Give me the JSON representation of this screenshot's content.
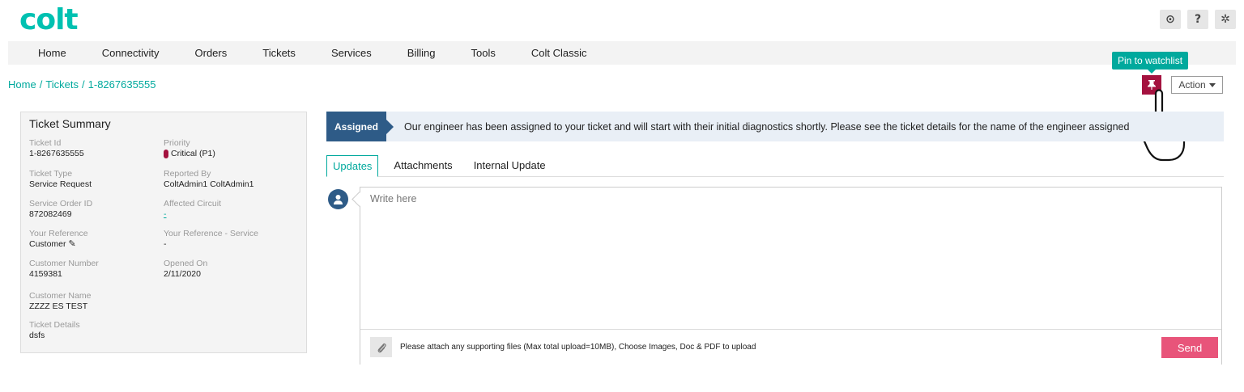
{
  "brand": {
    "logo_text": "colt",
    "accent_color": "#00c1b1"
  },
  "top_icons": [
    {
      "icon": "globe-icon",
      "glyph": "⊙"
    },
    {
      "icon": "help-icon",
      "glyph": "?"
    },
    {
      "icon": "gear-icon",
      "glyph": "✲"
    }
  ],
  "nav": [
    "Home",
    "Connectivity",
    "Orders",
    "Tickets",
    "Services",
    "Billing",
    "Tools",
    "Colt Classic"
  ],
  "breadcrumb": [
    "Home",
    "Tickets",
    "1-8267635555"
  ],
  "pin": {
    "tooltip": "Pin to watchlist",
    "icon": "pin-icon",
    "color": "#a4123f"
  },
  "action": {
    "label": "Action"
  },
  "summary": {
    "title": "Ticket Summary",
    "fields": [
      {
        "label": "Ticket Id",
        "value": "1-8267635555"
      },
      {
        "label": "Priority",
        "value": "Critical (P1)"
      },
      {
        "label": "Ticket Type",
        "value": "Service Request"
      },
      {
        "label": "Reported By",
        "value": "ColtAdmin1 ColtAdmin1"
      },
      {
        "label": "Service Order ID",
        "value": "872082469"
      },
      {
        "label": "Affected Circuit",
        "value": "-"
      },
      {
        "label": "Your Reference",
        "value": "Customer"
      },
      {
        "label": "Your Reference - Service",
        "value": "-"
      },
      {
        "label": "Customer Number",
        "value": "4159381"
      },
      {
        "label": "Opened On",
        "value": "2/11/2020"
      },
      {
        "label": "Customer Name",
        "value": "ZZZZ ES TEST"
      },
      {
        "label": "Ticket Details",
        "value": "dsfs"
      }
    ]
  },
  "status": {
    "tag": "Assigned",
    "message": "Our engineer has been assigned to your ticket and will start with their initial diagnostics shortly. Please see the ticket details for the name of the engineer assigned"
  },
  "tabs": [
    "Updates",
    "Attachments",
    "Internal Update"
  ],
  "comment": {
    "placeholder": "Write here",
    "attach_note": "Please attach any supporting files (Max total upload=10MB), Choose Images, Doc & PDF to upload",
    "send_label": "Send",
    "send_color": "#e8547a"
  }
}
